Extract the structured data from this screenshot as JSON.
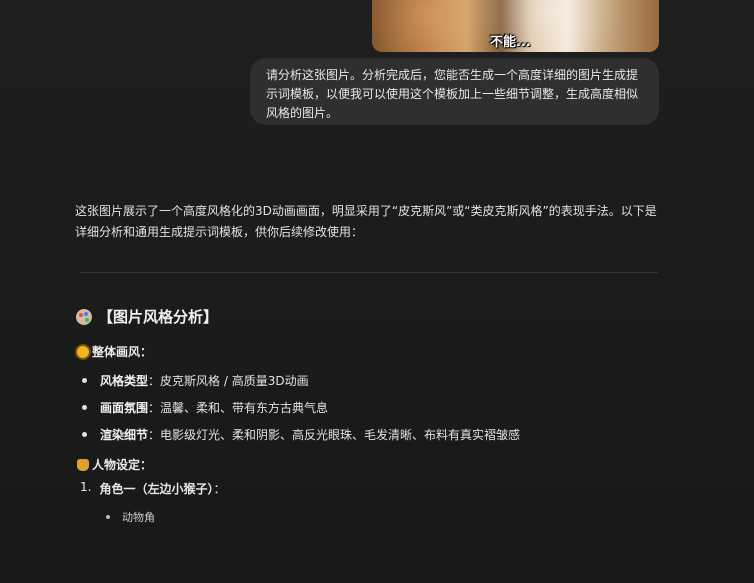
{
  "attachment": {
    "caption": "不能..."
  },
  "user_message": {
    "text": "请分析这张图片。分析完成后，您能否生成一个高度详细的图片生成提示词模板，以便我可以使用这个模板加上一些细节调整，生成高度相似风格的图片。"
  },
  "assistant": {
    "intro": "这张图片展示了一个高度风格化的3D动画画面，明显采用了“皮克斯风”或“类皮克斯风格”的表现手法。以下是详细分析和通用生成提示词模板，供你后续修改使用：",
    "section_icon": "palette-icon",
    "section_title": "【图片风格分析】",
    "overall": {
      "icon": "sun-icon",
      "title": "整体画风：",
      "items": [
        {
          "label": "风格类型",
          "value": "：皮克斯风格 / 高质量3D动画"
        },
        {
          "label": "画面氛围",
          "value": "：温馨、柔和、带有东方古典气息"
        },
        {
          "label": "渲染细节",
          "value": "：电影级灯光、柔和阴影、高反光眼珠、毛发清晰、布料有真实褶皱感"
        }
      ]
    },
    "characters": {
      "icon": "bag-icon",
      "title": "人物设定：",
      "item_number": "1.",
      "item_label": "角色一（左边小猴子）",
      "item_suffix": "：",
      "sub_item": "动物角"
    }
  }
}
